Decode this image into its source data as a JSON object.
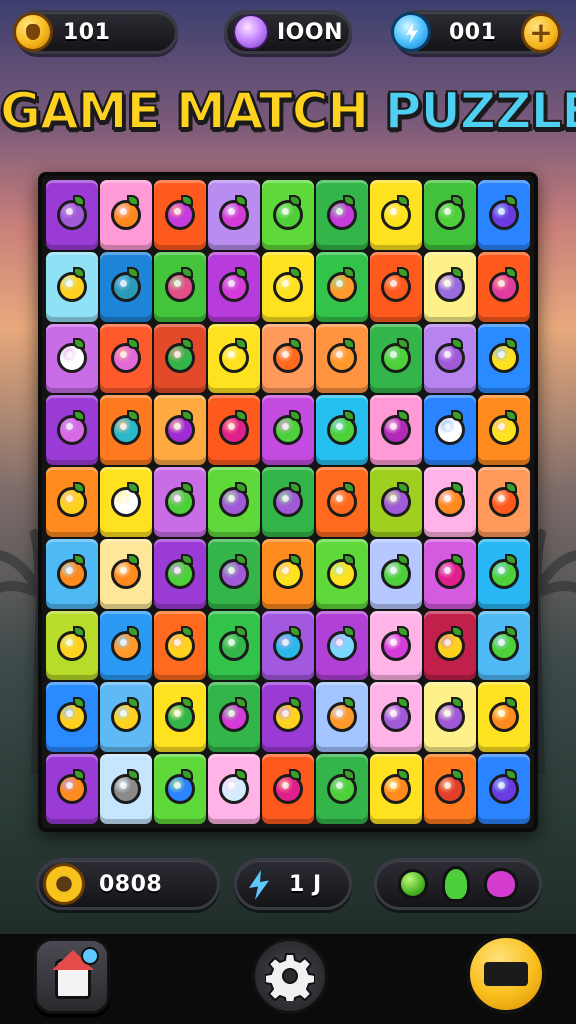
{
  "title": {
    "part1": "GAME MATCH ",
    "part2": "PUZZLE"
  },
  "top_hud": {
    "coins": "101",
    "gems": "IOON",
    "energy": "001"
  },
  "bottom_hud": {
    "score": "0808",
    "moves": "1 J"
  },
  "board": {
    "rows": 9,
    "cols": 9,
    "tiles": [
      [
        "#9b3bd6",
        "#ff9ad6",
        "#ff5a1e",
        "#b98cf0",
        "#5fd83a",
        "#33b54a",
        "#ffe21f",
        "#41c23a",
        "#2a84ff"
      ],
      [
        "#8fe1f5",
        "#1e84d8",
        "#43c43a",
        "#b83bdc",
        "#ffe21f",
        "#33c24a",
        "#ff5a1e",
        "#fff18a",
        "#ff5a1e"
      ],
      [
        "#c86de6",
        "#ff5a2b",
        "#e24a2a",
        "#ffe21f",
        "#ff9a5a",
        "#ff9340",
        "#33b54a",
        "#b783ef",
        "#2a8aff"
      ],
      [
        "#9b3bd6",
        "#ff7a1e",
        "#ffaa40",
        "#ff5a1e",
        "#c44be0",
        "#26c0f0",
        "#ff9ad6",
        "#2a84ff",
        "#ff8a1e"
      ],
      [
        "#ff8a1e",
        "#ffe21f",
        "#c86de6",
        "#5fd83a",
        "#33b54a",
        "#ff6a1e",
        "#9fd01f",
        "#ffb3e6",
        "#ff9a5a"
      ],
      [
        "#4fb9f5",
        "#ffe79a",
        "#9b3bd6",
        "#33b54a",
        "#ff8a1e",
        "#5fd83a",
        "#b5c8ff",
        "#d45ae0",
        "#2ab7f5"
      ],
      [
        "#b8dc2a",
        "#2a9af5",
        "#ff6a1e",
        "#33c24a",
        "#a259e0",
        "#b040d6",
        "#ffb3e6",
        "#c0204a",
        "#4fb9f5"
      ],
      [
        "#2a8aff",
        "#5fb9f5",
        "#ffe21f",
        "#33b54a",
        "#9b3bd6",
        "#a2c4ff",
        "#ffb3e6",
        "#fff18a",
        "#ffe21f"
      ],
      [
        "#9b3bd6",
        "#c6e6ff",
        "#5fd83a",
        "#ffb3e6",
        "#ff5a1e",
        "#33b54a",
        "#ffe21f",
        "#ff7a1e",
        "#2a84ff"
      ]
    ],
    "fruits": [
      [
        "#a05ad8",
        "#ff8a1e",
        "#c53bdc",
        "#d43bd8",
        "#4ed03a",
        "#c53bdc",
        "#ffe21f",
        "#4ed03a",
        "#6a3be0"
      ],
      [
        "#ffd21f",
        "#2a9ab8",
        "#e2508a",
        "#d43bd8",
        "#ffe21f",
        "#ff9a2a",
        "#ff5a1e",
        "#9b6be0",
        "#e23ba0"
      ],
      [
        "#ffffff",
        "#e26ad6",
        "#33b54a",
        "#ffe21f",
        "#ff6a1e",
        "#ff9a2a",
        "#4ed03a",
        "#a05ad8",
        "#ffe21f"
      ],
      [
        "#d86ae6",
        "#2ab8c8",
        "#a02ad6",
        "#e0208a",
        "#4ed03a",
        "#4ed03a",
        "#b02ab8",
        "#ffffff",
        "#ffe21f"
      ],
      [
        "#ffd21f",
        "#ffffff",
        "#4ed03a",
        "#a05ad8",
        "#a05ad8",
        "#ff6a1e",
        "#a05ad8",
        "#ff8a1e",
        "#ff5a1e"
      ],
      [
        "#ff8a1e",
        "#ff8a1e",
        "#4ed03a",
        "#a05ad8",
        "#ffe21f",
        "#ffe21f",
        "#4ed03a",
        "#e0208a",
        "#4ed03a"
      ],
      [
        "#ffd21f",
        "#ff9a2a",
        "#ffd21f",
        "#33b54a",
        "#2ab8e8",
        "#7ad8ff",
        "#d43bd8",
        "#ffd21f",
        "#4ed03a"
      ],
      [
        "#ffd21f",
        "#ffd21f",
        "#33b54a",
        "#d43bd8",
        "#ffd21f",
        "#ff9a2a",
        "#a05ad8",
        "#a05ad8",
        "#ff8a1e"
      ],
      [
        "#ff8a1e",
        "#8a8a8a",
        "#2a84ff",
        "#d6ecff",
        "#e0208a",
        "#4ed03a",
        "#ff8a1e",
        "#e2402a",
        "#6a3be0"
      ]
    ]
  },
  "icons": {
    "coin": "coin-icon",
    "gem": "gem-icon",
    "energy": "bolt-icon",
    "plus": "plus-icon",
    "score": "flower-icon",
    "moves": "bolt-icon",
    "home": "home-icon",
    "settings": "gear-icon",
    "play": "play-icon"
  },
  "colors": {
    "title_yellow": "#ffd21f",
    "title_blue": "#4fd0f2",
    "accent_gold": "#f8b81c",
    "board_bg": "#141414"
  }
}
